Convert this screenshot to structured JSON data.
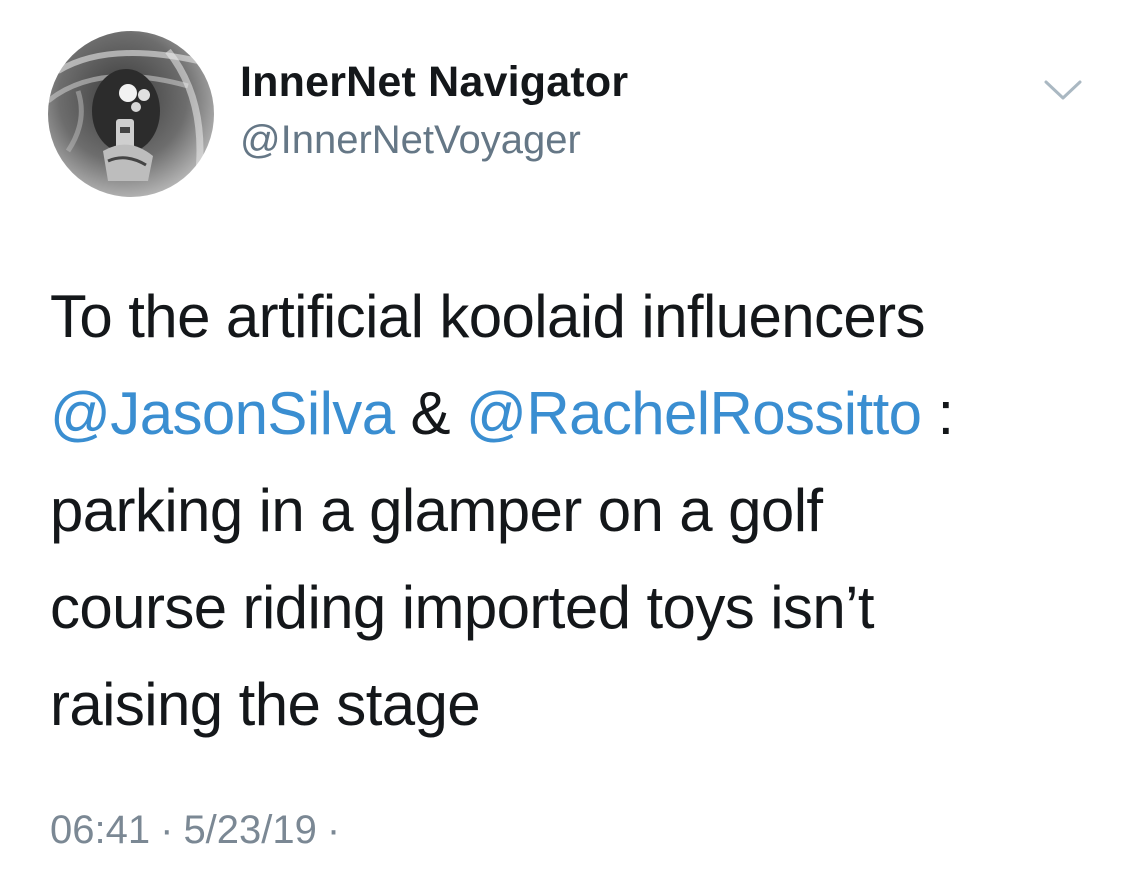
{
  "author": {
    "display_name": "InnerNet Navigator",
    "handle": "@InnerNetVoyager",
    "avatar_icon": "profile-photo-avatar"
  },
  "menu": {
    "caret_icon": "chevron-down-icon"
  },
  "tweet": {
    "line1": "To the artificial koolaid influencers",
    "mention1": "@JasonSilva",
    "amp": " & ",
    "mention2": "@RachelRossitto",
    "colon": " :",
    "line3": "parking in a glamper on a golf",
    "line4": "course riding imported toys isn’t",
    "line5": "raising the stage"
  },
  "meta": {
    "time": "06:41",
    "separator": "·",
    "date": "5/23/19",
    "trailing_separator": "·"
  },
  "colors": {
    "link": "#3a8ed1",
    "text": "#14171a",
    "secondary": "#657786"
  }
}
